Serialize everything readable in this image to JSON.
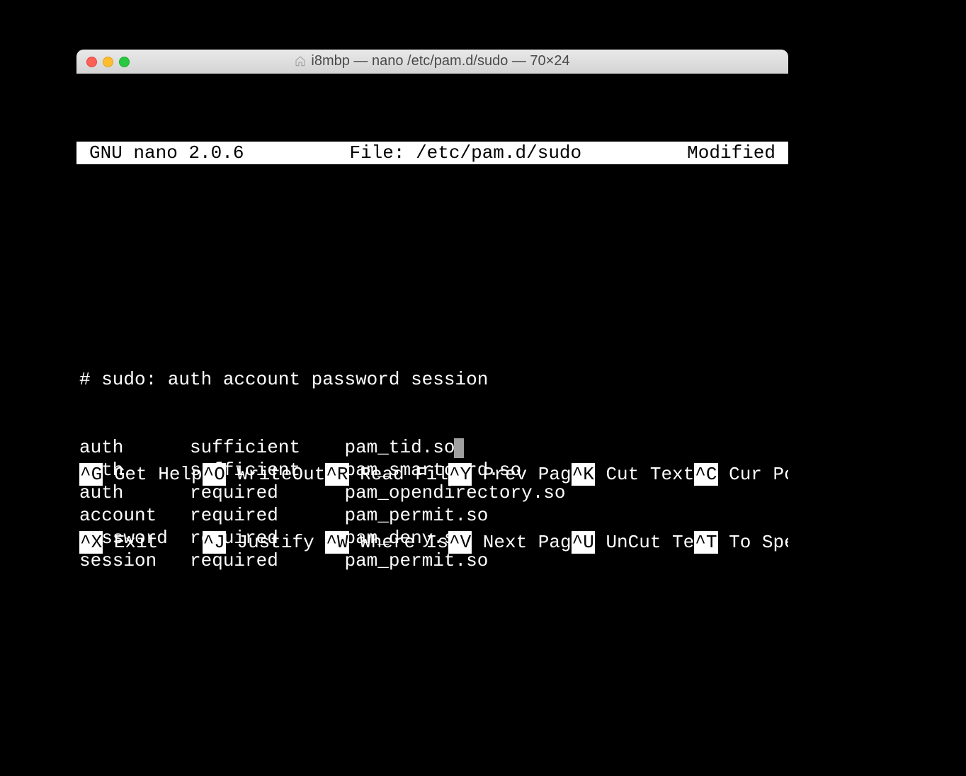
{
  "window": {
    "title": "i8mbp — nano /etc/pam.d/sudo — 70×24"
  },
  "editor": {
    "app": "GNU nano 2.0.6",
    "file_label": "File: /etc/pam.d/sudo",
    "status": "Modified",
    "comment": "# sudo: auth account password session",
    "lines": [
      {
        "type": "auth",
        "control": "sufficient",
        "module": "pam_tid.so",
        "cursor": true
      },
      {
        "type": "auth",
        "control": "sufficient",
        "module": "pam_smartcard.so",
        "cursor": false
      },
      {
        "type": "auth",
        "control": "required",
        "module": "pam_opendirectory.so",
        "cursor": false
      },
      {
        "type": "account",
        "control": "required",
        "module": "pam_permit.so",
        "cursor": false
      },
      {
        "type": "password",
        "control": "required",
        "module": "pam_deny.so",
        "cursor": false
      },
      {
        "type": "session",
        "control": "required",
        "module": "pam_permit.so",
        "cursor": false
      }
    ]
  },
  "footer": {
    "row1": [
      {
        "key": "^G",
        "label": " Get Help"
      },
      {
        "key": "^O",
        "label": " WriteOut"
      },
      {
        "key": "^R",
        "label": " Read Fil"
      },
      {
        "key": "^Y",
        "label": " Prev Pag"
      },
      {
        "key": "^K",
        "label": " Cut Text"
      },
      {
        "key": "^C",
        "label": " Cur Pos"
      }
    ],
    "row2": [
      {
        "key": "^X",
        "label": " Exit    "
      },
      {
        "key": "^J",
        "label": " Justify "
      },
      {
        "key": "^W",
        "label": " Where Is"
      },
      {
        "key": "^V",
        "label": " Next Pag"
      },
      {
        "key": "^U",
        "label": " UnCut Te"
      },
      {
        "key": "^T",
        "label": " To Spell"
      }
    ]
  }
}
